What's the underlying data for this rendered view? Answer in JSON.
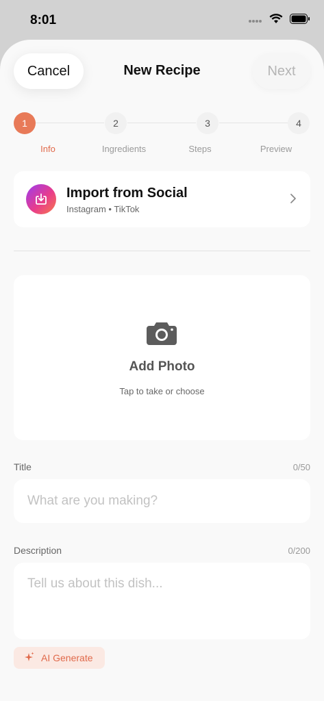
{
  "status_bar": {
    "time": "8:01"
  },
  "nav": {
    "cancel_label": "Cancel",
    "title": "New Recipe",
    "next_label": "Next"
  },
  "stepper": {
    "steps": [
      {
        "number": "1",
        "label": "Info",
        "active": true
      },
      {
        "number": "2",
        "label": "Ingredients",
        "active": false
      },
      {
        "number": "3",
        "label": "Steps",
        "active": false
      },
      {
        "number": "4",
        "label": "Preview",
        "active": false
      }
    ]
  },
  "import_card": {
    "title": "Import from Social",
    "subtitle": "Instagram • TikTok",
    "icon": "import-icon"
  },
  "photo": {
    "title": "Add Photo",
    "subtitle": "Tap to take or choose",
    "icon": "camera-icon"
  },
  "title_field": {
    "label": "Title",
    "count": "0/50",
    "placeholder": "What are you making?",
    "value": ""
  },
  "description_field": {
    "label": "Description",
    "count": "0/200",
    "placeholder": "Tell us about this dish...",
    "value": ""
  },
  "ai_button": {
    "label": "AI Generate",
    "icon": "sparkle-icon"
  },
  "colors": {
    "accent": "#e87a58",
    "background": "#f9f9f9",
    "card": "#ffffff"
  }
}
